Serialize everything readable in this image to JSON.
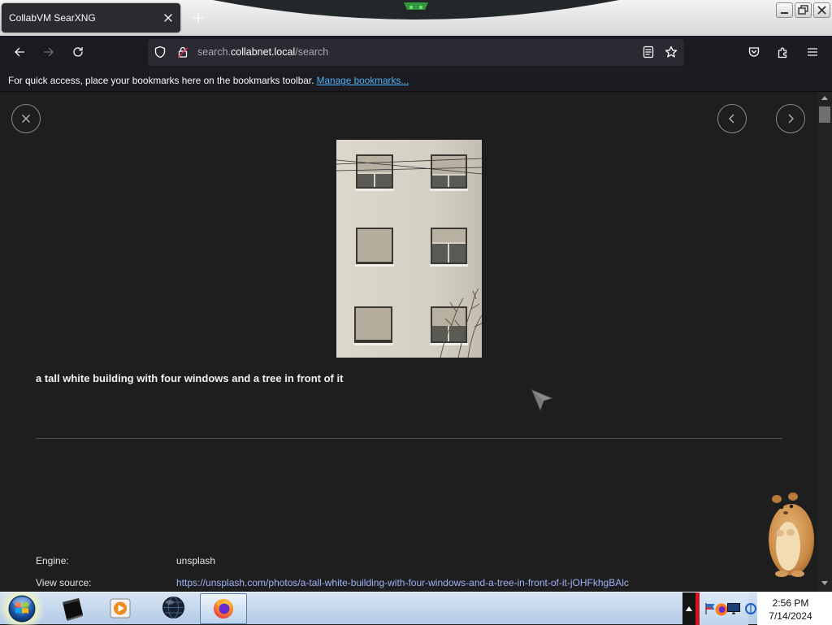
{
  "browser": {
    "tab": {
      "title": "CollabVM SearXNG"
    },
    "url": {
      "subdomain": "search.",
      "domain": "collabnet.local",
      "path": "/search"
    },
    "bookmarks_toolbar": {
      "message": "For quick access, place your bookmarks here on the bookmarks toolbar.",
      "manage_link": "Manage bookmarks..."
    }
  },
  "detail": {
    "caption": "a tall white building with four windows and a tree in front of it",
    "fields": [
      {
        "label": "Engine:",
        "value": "unsplash"
      },
      {
        "label": "View source:",
        "value": "https://unsplash.com/photos/a-tall-white-building-with-four-windows-and-a-tree-in-front-of-it-jOHFkhgBAlc"
      }
    ]
  },
  "taskbar": {
    "clock": {
      "time": "2:56 PM",
      "date": "7/14/2024"
    }
  },
  "icons": {
    "titlebar": [
      "tab-close-icon",
      "new-tab-plus-icon",
      "minimize-icon",
      "restore-icon",
      "window-close-icon"
    ],
    "navigation": [
      "back-arrow-icon",
      "forward-arrow-icon",
      "reload-icon",
      "tracking-shield-icon",
      "insecure-lock-icon",
      "reader-view-icon",
      "bookmark-star-icon",
      "pocket-icon",
      "extensions-puzzle-icon",
      "hamburger-menu-icon"
    ],
    "viewer": [
      "close-icon",
      "chevron-left-icon",
      "chevron-right-icon"
    ],
    "taskbar": [
      "start-orb-icon",
      "black-box-app-icon",
      "media-player-icon",
      "globe-app-icon",
      "firefox-icon",
      "show-hidden-icons-arrow-icon",
      "network-flag-icon",
      "display-icon",
      "blue-globe-tray-icon"
    ]
  },
  "colors": {
    "toolbar-bg": "#1c1b22",
    "urlbar-bg": "#2b2a33",
    "content-bg": "#1e1e1e",
    "result-link": "#9fb2f7",
    "bookmark-link": "#4fb0f5",
    "taskbar-top": "#d6e4f3",
    "taskbar-bottom": "#b3cbe6",
    "tray-alert": "#d4141c"
  }
}
